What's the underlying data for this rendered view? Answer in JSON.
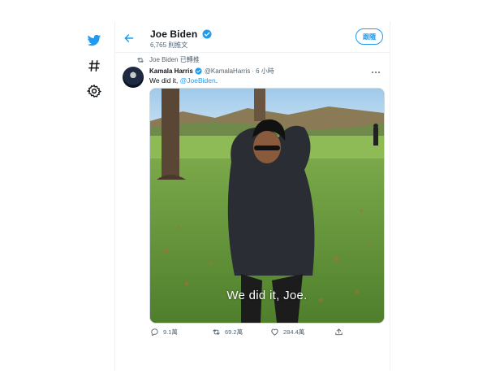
{
  "colors": {
    "accent": "#1d9bf0",
    "text": "#0f1419",
    "muted": "#536471",
    "border": "#eff3f4"
  },
  "nav": [
    {
      "icon": "twitter-logo-icon"
    },
    {
      "icon": "hashtag-explore-icon"
    },
    {
      "icon": "settings-gear-icon"
    }
  ],
  "header": {
    "name": "Joe Biden",
    "tweet_count": "6,765 則推文",
    "follow_label": "跟隨"
  },
  "tweet": {
    "retweet_context": "Joe Biden 已轉推",
    "author_name": "Kamala Harris",
    "author_handle": "@KamalaHarris",
    "separator": "·",
    "time": "6 小時",
    "text_prefix": "We did it, ",
    "mention": "@JoeBiden",
    "text_suffix": ".",
    "media_caption": "We did it, Joe.",
    "stats": {
      "replies": "9.1萬",
      "retweets": "69.2萬",
      "likes": "284.4萬"
    }
  }
}
